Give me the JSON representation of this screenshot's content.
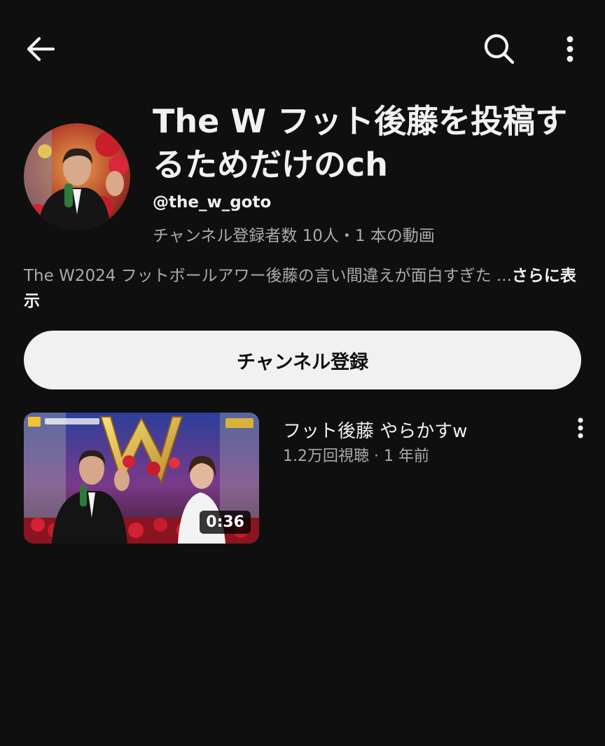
{
  "topbar": {
    "back_icon": "arrow-left-icon",
    "search_icon": "search-icon",
    "more_icon": "more-vert-icon"
  },
  "channel": {
    "title": "The W フット後藤を投稿するためだけのch",
    "handle": "@the_w_goto",
    "stats": "チャンネル登録者数 10人・1 本の動画",
    "description": "The W2024 フットボールアワー後藤の言い間違えが面白すぎた ...",
    "description_more": "さらに表示"
  },
  "subscribe": {
    "label": "チャンネル登録"
  },
  "videos": [
    {
      "title": "フット後藤 やらかすw",
      "meta": "1.2万回視聴 · 1 年前",
      "duration": "0:36"
    }
  ],
  "colors": {
    "background": "#0f0f0f",
    "primary_text": "#f1f1f1",
    "secondary_text": "#aaaaaa",
    "subscribe_bg": "#f1f1f1"
  }
}
